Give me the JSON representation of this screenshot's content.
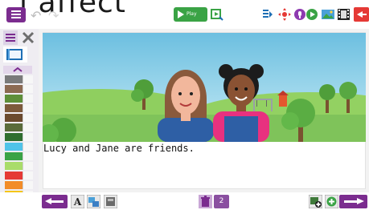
{
  "toolbar": {
    "background_text": "l affect",
    "play_label": "Play"
  },
  "book": {
    "caption": "Lucy and Jane are friends."
  },
  "pagination": {
    "page_count": "2"
  },
  "colors": {
    "accent_purple": "#7b2c8f",
    "play_green": "#3aa345",
    "exit_red": "#e53935",
    "sky_blue": "#7ec8e3",
    "grass_green": "#7fc35a"
  },
  "icons": [
    "menu-icon",
    "undo-icon",
    "redo-icon",
    "play-icon",
    "preview-icon",
    "text-direction-icon",
    "move-icon",
    "record-icon",
    "play-audio-icon",
    "image-icon",
    "video-icon",
    "exit-icon",
    "list-icon",
    "settings-icon",
    "book-icon",
    "scroll-up-icon",
    "scroll-down-icon",
    "prev-page-icon",
    "text-icon",
    "image-text-icon",
    "layout-icon",
    "trash-icon",
    "add-image-icon",
    "add-page-icon",
    "next-page-icon"
  ]
}
